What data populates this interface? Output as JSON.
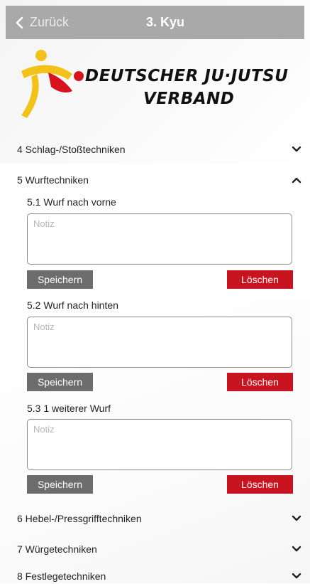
{
  "nav": {
    "back_label": "Zurück",
    "title": "3. Kyu"
  },
  "logo": {
    "line1": "DEUTSCHER JU·JUTSU",
    "line2": "VERBAND",
    "accent_red": "#d7141e",
    "accent_yellow": "#f2c219"
  },
  "sections": {
    "s4": {
      "label": "4 Schlag-/Stoßtechniken",
      "icon": "chevron-down-icon"
    },
    "s5": {
      "label": "5 Wurftechniken",
      "icon": "chevron-up-icon"
    },
    "s6": {
      "label": "6 Hebel-/Pressgrifftechniken",
      "icon": "chevron-down-icon"
    },
    "s7": {
      "label": "7 Würgetechniken",
      "icon": "chevron-down-icon"
    },
    "s8": {
      "label": "8 Festlegetechniken",
      "icon": "chevron-down-icon"
    }
  },
  "techniques": [
    {
      "label": "5.1 Wurf nach vorne",
      "placeholder": "Notiz",
      "value": "",
      "save_label": "Speichern",
      "delete_label": "Löschen"
    },
    {
      "label": "5.2 Wurf nach hinten",
      "placeholder": "Notiz",
      "value": "",
      "save_label": "Speichern",
      "delete_label": "Löschen"
    },
    {
      "label": "5.3 1 weiterer Wurf",
      "placeholder": "Notiz",
      "value": "",
      "save_label": "Speichern",
      "delete_label": "Löschen"
    }
  ],
  "colors": {
    "navbar": "#a9a9a9",
    "save_button": "#6d6d6d",
    "delete_button": "#c8141e"
  }
}
